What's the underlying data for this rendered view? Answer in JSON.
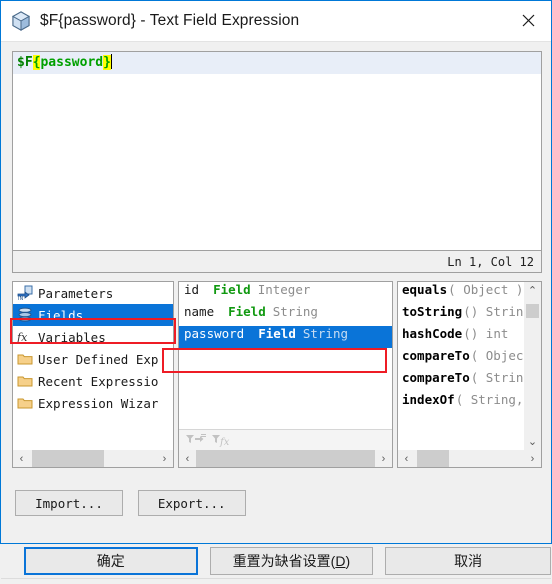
{
  "window": {
    "title": "$F{password} - Text Field Expression",
    "icon": "cube-icon",
    "close_label": "✕",
    "accent_color": "#0078d7"
  },
  "editor": {
    "expression": "$F{password}",
    "tokens": {
      "prefix": "$F",
      "open_brace": "{",
      "identifier": "password",
      "close_brace": "}"
    },
    "colors": {
      "text": "#008000",
      "brace_highlight": "#ffff00",
      "current_line": "#e8eef8"
    },
    "status": "Ln 1, Col 12"
  },
  "tree": {
    "items": [
      {
        "label": "Parameters",
        "icon": "parameters-in-icon",
        "selected": false
      },
      {
        "label": "Fields",
        "icon": "fields-database-icon",
        "selected": true
      },
      {
        "label": "Variables",
        "icon": "variables-fx-icon",
        "selected": false
      },
      {
        "label": "User Defined Exp",
        "icon": "folder-icon",
        "selected": false
      },
      {
        "label": "Recent Expressio",
        "icon": "folder-icon",
        "selected": false
      },
      {
        "label": "Expression Wizar",
        "icon": "folder-icon",
        "selected": false
      }
    ],
    "scrollbar": {
      "left_arrow": "‹",
      "right_arrow": "›"
    }
  },
  "fields": {
    "rows": [
      {
        "name": "id",
        "kind": "Field",
        "type": "Integer",
        "selected": false
      },
      {
        "name": "name",
        "kind": "Field",
        "type": "String",
        "selected": false
      },
      {
        "name": "password",
        "kind": "Field",
        "type": "String",
        "selected": true
      }
    ],
    "footer_icons": [
      {
        "name": "filter-parameters-icon"
      },
      {
        "name": "filter-expression-icon"
      }
    ],
    "scrollbar": {
      "left_arrow": "‹",
      "right_arrow": "›"
    }
  },
  "methods": {
    "rows": [
      {
        "name": "equals",
        "signature": "( Object )"
      },
      {
        "name": "toString",
        "signature": "() String"
      },
      {
        "name": "hashCode",
        "signature": "() int"
      },
      {
        "name": "compareTo",
        "signature": "( Objec"
      },
      {
        "name": "compareTo",
        "signature": "( Strin"
      },
      {
        "name": "indexOf",
        "signature": "( String,"
      }
    ],
    "scrollbar": {
      "up_arrow": "⌃",
      "down_arrow": "⌄",
      "left_arrow": "‹",
      "right_arrow": "›"
    }
  },
  "toolbar": {
    "import_label": "Import...",
    "export_label": "Export..."
  },
  "footer": {
    "ok_label": "确定",
    "reset_label_pre": "重置为缺省设置(",
    "reset_mnemonic": "D",
    "reset_label_post": ")",
    "cancel_label": "取消"
  },
  "annotations": {
    "highlight_color": "#ee1c25",
    "boxes": [
      "fields-tree-item",
      "password-field-row"
    ]
  }
}
